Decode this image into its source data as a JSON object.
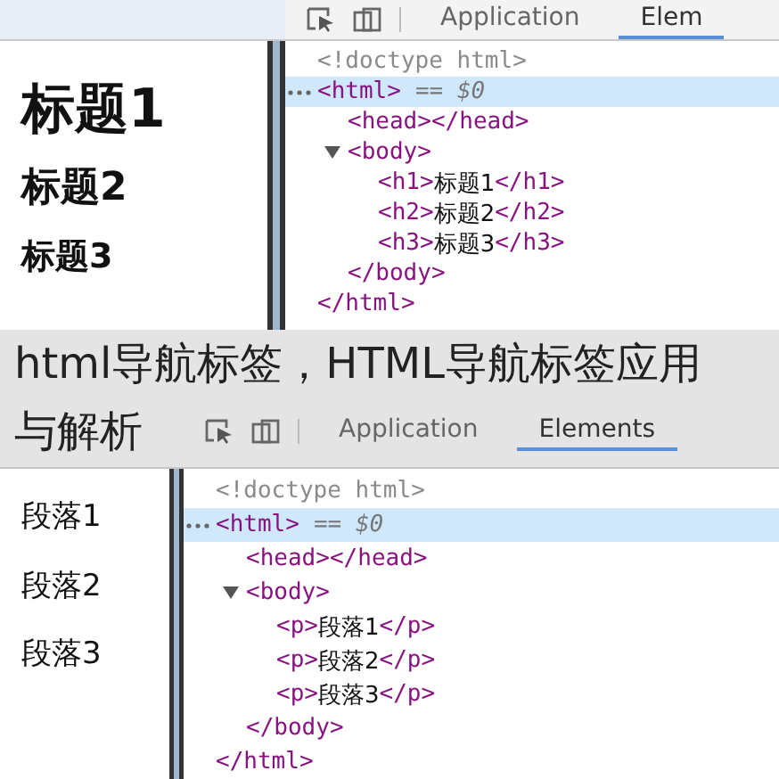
{
  "panels": [
    {
      "page_items": [
        {
          "kind": "h1",
          "text": "标题1"
        },
        {
          "kind": "h2",
          "text": "标题2"
        },
        {
          "kind": "h3",
          "text": "标题3"
        }
      ],
      "tabs": [
        {
          "label": "Application",
          "selected": false
        },
        {
          "label": "Elem",
          "selected": true
        }
      ],
      "dom": [
        {
          "kind": "doctype",
          "open": "<!doctype html>"
        },
        {
          "kind": "element",
          "open": "<html>",
          "note": "== $0",
          "selected": true,
          "close": "</html>",
          "children": [
            {
              "kind": "element",
              "open": "<head>",
              "close": "</head>",
              "selected": false
            },
            {
              "kind": "element",
              "open": "<body>",
              "expanded": true,
              "selected": false,
              "close": "</body>",
              "children": [
                {
                  "kind": "element",
                  "open": "<h1>",
                  "text": "标题1",
                  "close": "</h1>",
                  "selected": false
                },
                {
                  "kind": "element",
                  "open": "<h2>",
                  "text": "标题2",
                  "close": "</h2>",
                  "selected": false
                },
                {
                  "kind": "element",
                  "open": "<h3>",
                  "text": "标题3",
                  "close": "</h3>",
                  "selected": false
                }
              ]
            }
          ]
        }
      ]
    },
    {
      "page_items": [
        {
          "kind": "p",
          "text": "段落1"
        },
        {
          "kind": "p",
          "text": "段落2"
        },
        {
          "kind": "p",
          "text": "段落3"
        }
      ],
      "tabs": [
        {
          "label": "Application",
          "selected": false
        },
        {
          "label": "Elements",
          "selected": true
        }
      ],
      "dom": [
        {
          "kind": "doctype",
          "open": "<!doctype html>"
        },
        {
          "kind": "element",
          "open": "<html>",
          "note": "== $0",
          "selected": true,
          "close": "</html>",
          "children": [
            {
              "kind": "element",
              "open": "<head>",
              "close": "</head>",
              "selected": false
            },
            {
              "kind": "element",
              "open": "<body>",
              "expanded": true,
              "selected": false,
              "close": "</body>",
              "children": [
                {
                  "kind": "element",
                  "open": "<p>",
                  "text": "段落1",
                  "close": "</p>",
                  "selected": false
                },
                {
                  "kind": "element",
                  "open": "<p>",
                  "text": "段落2",
                  "close": "</p>",
                  "selected": false
                },
                {
                  "kind": "element",
                  "open": "<p>",
                  "text": "段落3",
                  "close": "</p>",
                  "selected": false
                }
              ]
            }
          ]
        }
      ]
    }
  ],
  "caption_lines": [
    "html导航标签，HTML导航标签应用",
    "与解析"
  ]
}
